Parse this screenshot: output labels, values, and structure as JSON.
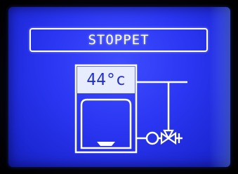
{
  "screen": {
    "status_label": "STOPPET",
    "boiler_temperature": "44°c"
  },
  "icons": {
    "boiler": "boiler-tank-icon",
    "pump": "pump-icon",
    "valve": "three-way-valve-icon"
  },
  "colors": {
    "lcd_background": "#2a36f2",
    "foreground": "#ffffff",
    "highlight_text": "#2230d0"
  }
}
